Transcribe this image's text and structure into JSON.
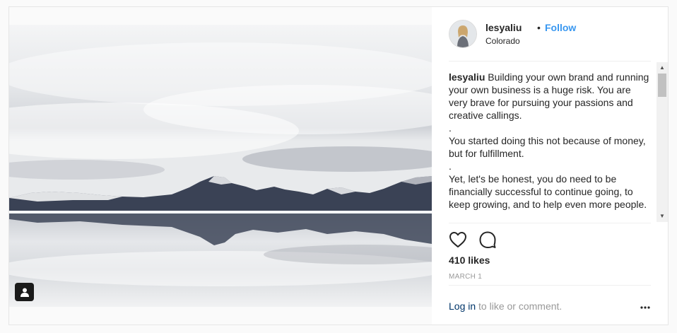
{
  "post": {
    "username": "lesyaliu",
    "dot": "•",
    "follow_label": "Follow",
    "location": "Colorado",
    "caption_user": "lesyaliu",
    "caption_text": " Building your own brand and running your own business is a huge risk. You are very brave for pursuing your passions and creative callings.\n.\nYou started doing this not because of money, but for fulfillment.\n.\nYet, let's be honest, you do need to be financially successful to continue going, to keep growing, and to help even more people.",
    "likes": "410 likes",
    "date": "MARCH 1",
    "login_link": "Log in",
    "login_rest": " to like or comment."
  },
  "icons": {
    "tag": "person-tag-icon",
    "like": "heart-icon",
    "comment": "comment-bubble-icon",
    "more": "more-options-icon",
    "scroll_up": "scroll-up-arrow-icon",
    "scroll_down": "scroll-down-arrow-icon"
  },
  "colors": {
    "follow": "#3897f0",
    "link": "#003569",
    "muted": "#999999",
    "text": "#262626"
  }
}
